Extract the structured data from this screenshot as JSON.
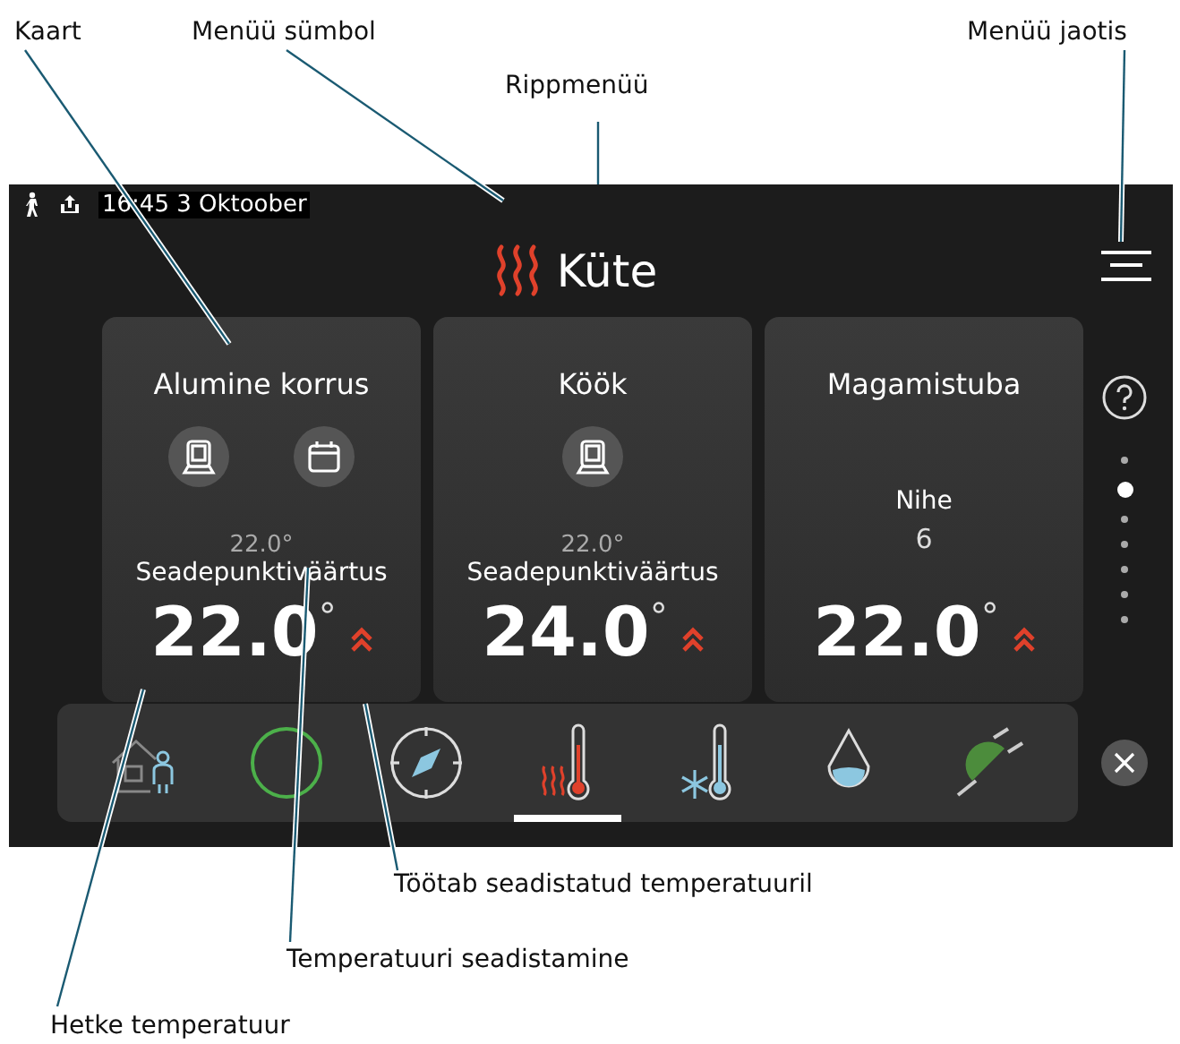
{
  "callouts": [
    {
      "text": "Kaart"
    },
    {
      "text": "Menüü sümbol"
    },
    {
      "text": "Rippmenüü"
    },
    {
      "text": "Menüü jaotis"
    },
    {
      "text": "Töötab seadistatud temperatuuril"
    },
    {
      "text": "Temperatuuri seadistamine"
    },
    {
      "text": "Hetke temperatuur"
    }
  ],
  "status_bar": {
    "time": "16:45 3 Oktoober"
  },
  "header": {
    "title": "Küte"
  },
  "cards": [
    {
      "title": "Alumine korrus",
      "kind": "setpoint",
      "thermostat": true,
      "schedule": true,
      "setpoint_label": "Seadepunktiväärtus",
      "setpoint": "22.0°",
      "temperature": "22.0",
      "unit": "°",
      "heating": true
    },
    {
      "title": "Köök",
      "kind": "setpoint",
      "thermostat": true,
      "schedule": false,
      "setpoint_label": "Seadepunktiväärtus",
      "setpoint": "22.0°",
      "temperature": "24.0",
      "unit": "°",
      "heating": true
    },
    {
      "title": "Magamistuba",
      "kind": "offset",
      "thermostat": false,
      "schedule": false,
      "setpoint_label": "Nihe",
      "setpoint": "6",
      "temperature": "22.0",
      "unit": "°",
      "heating": true
    }
  ],
  "page_dots": [
    {
      "selected": false
    },
    {
      "selected": true
    },
    {
      "selected": false
    },
    {
      "selected": false
    },
    {
      "selected": false
    },
    {
      "selected": false
    },
    {
      "selected": false
    }
  ],
  "nav": [
    {
      "kind": "home",
      "selected": false
    },
    {
      "kind": "ring",
      "selected": false
    },
    {
      "kind": "compass",
      "selected": false
    },
    {
      "kind": "heating",
      "selected": true
    },
    {
      "kind": "cooling",
      "selected": false
    },
    {
      "kind": "water",
      "selected": false
    },
    {
      "kind": "plug",
      "selected": false
    }
  ]
}
